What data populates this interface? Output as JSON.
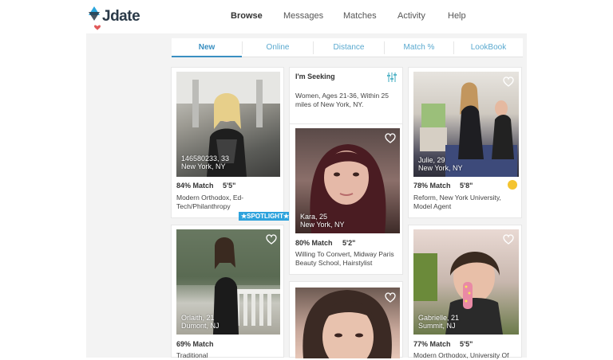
{
  "brand": {
    "name": "Jdate"
  },
  "nav": {
    "items": [
      {
        "label": "Browse",
        "active": true
      },
      {
        "label": "Messages"
      },
      {
        "label": "Matches"
      },
      {
        "label": "Activity"
      },
      {
        "label": "Help"
      }
    ]
  },
  "tabs": [
    {
      "label": "New",
      "active": true
    },
    {
      "label": "Online"
    },
    {
      "label": "Distance"
    },
    {
      "label": "Match %"
    },
    {
      "label": "LookBook"
    }
  ],
  "seeking": {
    "title": "I'm Seeking",
    "text": "Women, Ages 21-36, Within 25 miles of New York, NY."
  },
  "profiles": [
    {
      "name": "146580233, 33",
      "location": "New York, NY",
      "match": "84% Match",
      "height": "5'5\"",
      "desc": "Modern Orthodox, Ed-Tech/Philanthropy",
      "spotlight": "SPOTLIGHT"
    },
    {
      "name": "Orlaith, 21",
      "location": "Dumont, NJ",
      "match": "69% Match",
      "height": "",
      "desc": "Traditional"
    },
    {
      "name": "Kara, 25",
      "location": "New York, NY",
      "match": "80% Match",
      "height": "5'2\"",
      "desc": "Willing To Convert, Midway Paris Beauty School, Hairstylist"
    },
    {
      "name": "Julie, 29",
      "location": "New York, NY",
      "match": "78% Match",
      "height": "5'8\"",
      "desc": "Reform, New York University, Model Agent"
    },
    {
      "name": "Gabrielle, 21",
      "location": "Summit, NJ",
      "match": "77% Match",
      "height": "5'5\"",
      "desc": "Modern Orthodox, University Of"
    }
  ],
  "colors": {
    "accent": "#3a8fc1",
    "spotlight": "#2ea3dd",
    "logo_blue": "#2ba5dc",
    "logo_red": "#e15a5a"
  }
}
